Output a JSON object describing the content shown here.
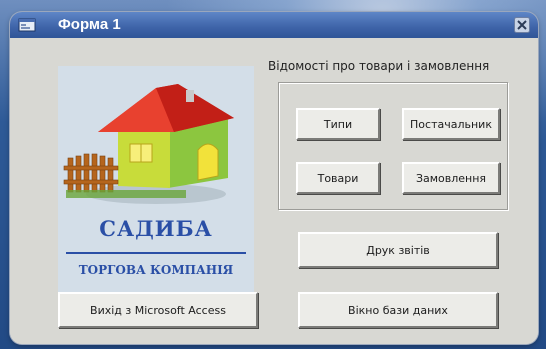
{
  "window": {
    "title": "Форма 1"
  },
  "logo": {
    "brand": "САДИБА",
    "subtitle": "ТОРГОВА КОМПАНІЯ"
  },
  "section": {
    "label": "Відомості про товари і замовлення"
  },
  "buttons": {
    "types": "Типи",
    "supplier": "Постачальник",
    "goods": "Товари",
    "orders": "Замовлення",
    "print_reports": "Друк звітів",
    "exit_access": "Вихід з Microsoft Access",
    "db_window": "Вікно бази даних"
  },
  "colors": {
    "titlebar": "#3e63a8",
    "form_bg": "#d8d8d3",
    "brand": "#2a4fa6"
  }
}
